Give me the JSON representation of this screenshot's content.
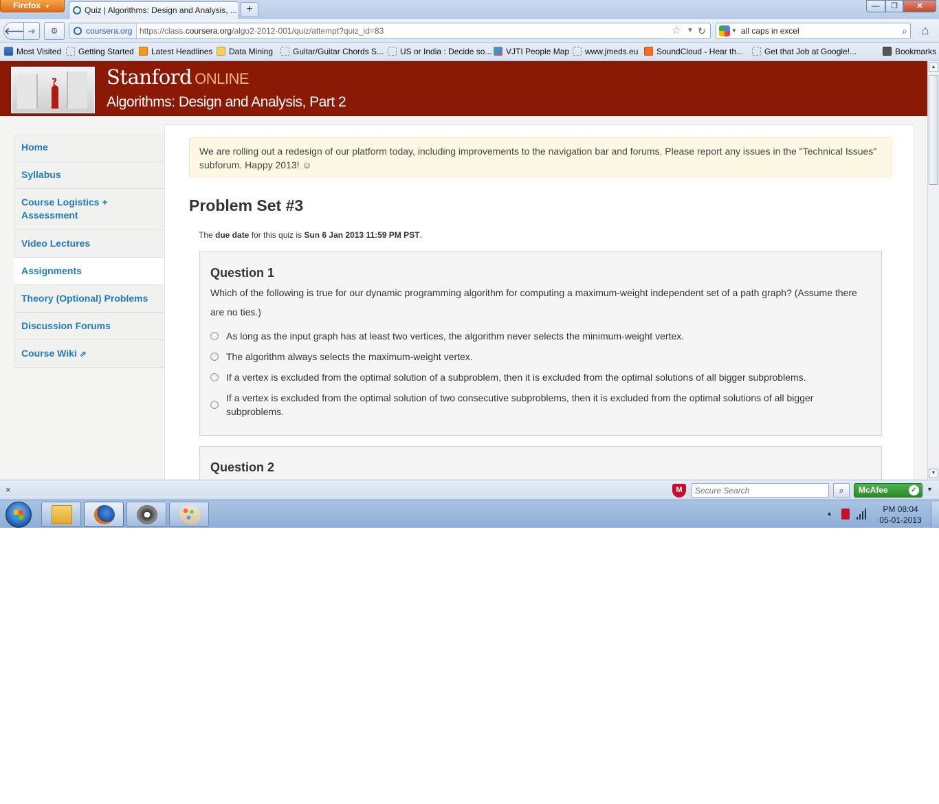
{
  "browser": {
    "app_button": "Firefox",
    "tab_title": "Quiz | Algorithms: Design and Analysis, ...",
    "tab_close": "×",
    "new_tab": "+",
    "window_controls": {
      "minimize": "—",
      "maximize": "❐",
      "close": "✕"
    },
    "site_identity": "coursera.org",
    "url_prefix": "https://class.",
    "url_domain": "coursera.org",
    "url_path": "/algo2-2012-001/quiz/attempt?quiz_id=83",
    "search_query": "all caps in excel",
    "icons": [
      "back-icon",
      "forward-icon",
      "bookmark-star-icon",
      "reload-icon",
      "search-icon",
      "home-icon"
    ]
  },
  "bookmarks": {
    "items": [
      {
        "label": "Most Visited",
        "icon": "page"
      },
      {
        "label": "Getting Started",
        "icon": "page"
      },
      {
        "label": "Latest Headlines",
        "icon": "rss"
      },
      {
        "label": "Data Mining",
        "icon": "folder"
      },
      {
        "label": "Guitar/Guitar Chords S...",
        "icon": "page"
      },
      {
        "label": "US or India : Decide so...",
        "icon": "page"
      },
      {
        "label": "VJTI People Map",
        "icon": "map"
      },
      {
        "label": "www.jmeds.eu",
        "icon": "page"
      },
      {
        "label": "SoundCloud - Hear th...",
        "icon": "soundcloud"
      },
      {
        "label": "Get that Job at Google!...",
        "icon": "page"
      }
    ],
    "bookmarks_menu": "Bookmarks"
  },
  "header": {
    "brand": "Stanford",
    "brand_suffix": "ONLINE",
    "course_title": "Algorithms: Design and Analysis, Part 2"
  },
  "sidebar": {
    "items": [
      {
        "label": "Home"
      },
      {
        "label": "Syllabus"
      },
      {
        "label": "Course Logistics + Assessment"
      },
      {
        "label": "Video Lectures"
      },
      {
        "label": "Assignments"
      },
      {
        "label": "Theory (Optional) Problems"
      },
      {
        "label": "Discussion Forums"
      },
      {
        "label": "Course Wiki"
      }
    ],
    "active": "Assignments",
    "external_icon": "⇗"
  },
  "main": {
    "notice": "We are rolling out a redesign of our platform today, including improvements to the navigation bar and forums. Please report any issues in the \"Technical Issues\" subforum. Happy 2013! ☺",
    "title": "Problem Set #3",
    "due_prefix": "The ",
    "due_label": "due date",
    "due_middle": " for this quiz is ",
    "due_value": "Sun 6 Jan 2013 11:59 PM PST",
    "due_suffix": ".",
    "questions": [
      {
        "title": "Question 1",
        "text": "Which of the following is true for our dynamic programming algorithm for computing a maximum-weight independent set of a path graph? (Assume there are no ties.)",
        "options": [
          "As long as the input graph has at least two vertices, the algorithm never selects the minimum-weight vertex.",
          "The algorithm always selects the maximum-weight vertex.",
          "If a vertex is excluded from the optimal solution of a subproblem, then it is excluded from the optimal solutions of all bigger subproblems.",
          "If a vertex is excluded from the optimal solution of two consecutive subproblems, then it is excluded from the optimal solutions of all bigger subproblems."
        ]
      },
      {
        "title": "Question 2"
      }
    ]
  },
  "addon_bar": {
    "close": "×",
    "shield": "M",
    "search_placeholder": "Secure Search",
    "mcafee_label": "McAfee",
    "check": "✓"
  },
  "taskbar": {
    "apps": [
      "Windows Explorer",
      "Firefox",
      "App",
      "Paint"
    ],
    "time": "PM 08:04",
    "date": "05-01-2013"
  }
}
